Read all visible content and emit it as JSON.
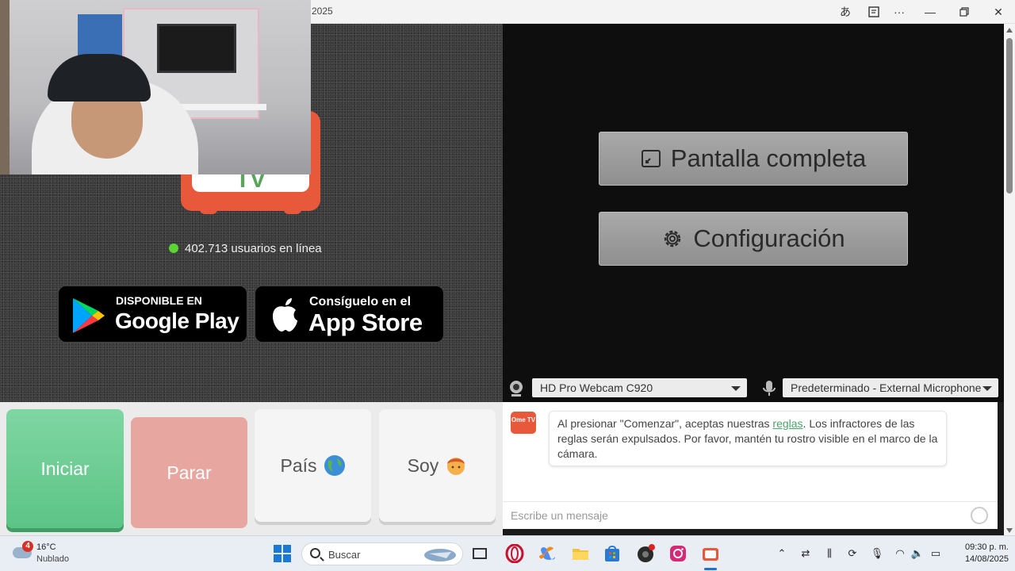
{
  "window": {
    "title_fragment": "2025",
    "icons": [
      "translate-icon",
      "reader-icon",
      "more-icon"
    ],
    "controls": [
      "minimize",
      "restore",
      "close"
    ]
  },
  "left": {
    "online_count_text": "402.713 usuarios en línea",
    "google_play": {
      "small": "DISPONIBLE EN",
      "big": "Google Play"
    },
    "app_store": {
      "small": "Consíguelo en el",
      "big": "App Store"
    },
    "logo_text": "TV"
  },
  "right": {
    "fullscreen_label": "Pantalla completa",
    "settings_label": "Configuración",
    "camera_select": "HD Pro Webcam C920",
    "mic_select": "Predeterminado - External Microphone"
  },
  "controls": {
    "start": "Iniciar",
    "stop": "Parar",
    "country": "País",
    "me": "Soy"
  },
  "chat": {
    "logo": "Ome TV",
    "message_before": "Al presionar \"Comenzar\", aceptas nuestras ",
    "message_link": "reglas",
    "message_after": ". Los infractores de las reglas serán expulsados. Por favor, mantén tu rostro visible en el marco de la cámara.",
    "input_placeholder": "Escribe un mensaje"
  },
  "taskbar": {
    "weather_badge": "4",
    "weather_temp": "16°C",
    "weather_desc": "Nublado",
    "search_label": "Buscar",
    "time": "09:30 p. m.",
    "date": "14/08/2025"
  },
  "colors": {
    "start_green": "#5cc486",
    "stop_red": "#e8a6a0",
    "online_dot": "#5ad632",
    "link_green": "#4aa36b",
    "brand_orange": "#e8583a"
  }
}
